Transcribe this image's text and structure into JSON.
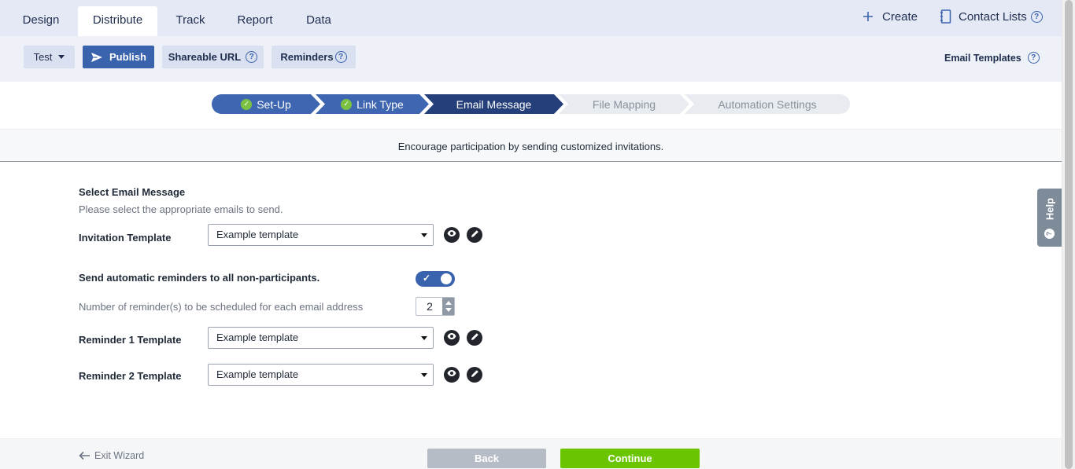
{
  "tabs": [
    {
      "label": "Design"
    },
    {
      "label": "Distribute",
      "active": true
    },
    {
      "label": "Track"
    },
    {
      "label": "Report"
    },
    {
      "label": "Data"
    }
  ],
  "top_actions": {
    "create_label": "Create",
    "contact_lists_label": "Contact Lists"
  },
  "toolbar": {
    "test_label": "Test",
    "publish_label": "Publish",
    "shareable_url_label": "Shareable URL",
    "reminders_label": "Reminders",
    "email_templates_label": "Email Templates"
  },
  "wizard_steps": [
    {
      "label": "Set-Up",
      "state": "done"
    },
    {
      "label": "Link Type",
      "state": "done"
    },
    {
      "label": "Email Message",
      "state": "current"
    },
    {
      "label": "File Mapping",
      "state": "todo"
    },
    {
      "label": "Automation Settings",
      "state": "todo"
    }
  ],
  "intro_text": "Encourage participation by sending customized invitations.",
  "form": {
    "section_title": "Select Email Message",
    "section_subtitle": "Please select the appropriate emails to send.",
    "invitation_label": "Invitation Template",
    "invitation_value": "Example template",
    "auto_reminders_label": "Send automatic reminders to all non-participants.",
    "auto_reminders_on": true,
    "reminder_count_label": "Number of reminder(s) to be scheduled for each email address",
    "reminder_count": "2",
    "reminder1_label": "Reminder 1 Template",
    "reminder1_value": "Example template",
    "reminder2_label": "Reminder 2 Template",
    "reminder2_value": "Example template"
  },
  "help_tab_label": "Help",
  "footer": {
    "exit_label": "Exit Wizard",
    "back_label": "Back",
    "continue_label": "Continue"
  },
  "colors": {
    "primary": "#3a63ad",
    "step_current": "#253f7b",
    "continue": "#6ac500",
    "back": "#b5bcc6"
  }
}
